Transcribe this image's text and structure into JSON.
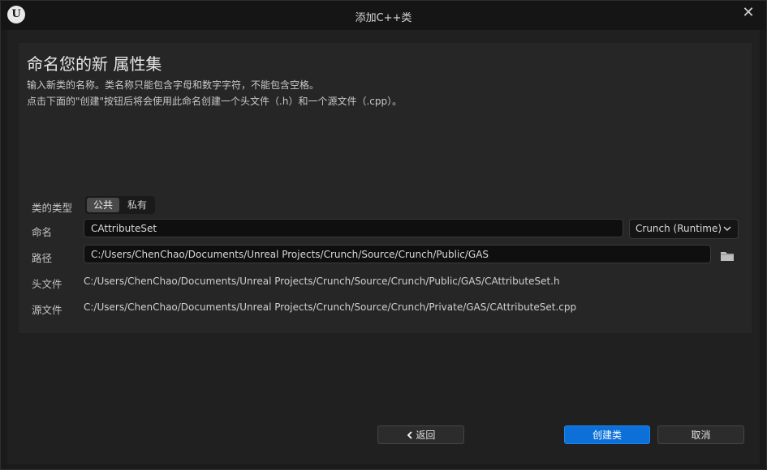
{
  "window": {
    "title": "添加C++类",
    "logo_letter": "U",
    "close_glyph": "✕"
  },
  "header": {
    "heading": "命名您的新 属性集",
    "description_line1": "输入新类的名称。类名称只能包含字母和数字字符，不能包含空格。",
    "description_line2": "点击下面的\"创建\"按钮后将会使用此命名创建一个头文件（.h）和一个源文件（.cpp）。"
  },
  "form": {
    "class_type_label": "类的类型",
    "class_type_options": [
      "公共",
      "私有"
    ],
    "class_type_selected": "公共",
    "name_label": "命名",
    "name_value": "CAttributeSet",
    "module_value": "Crunch (Runtime)",
    "path_label": "路径",
    "path_value": "C:/Users/ChenChao/Documents/Unreal Projects/Crunch/Source/Crunch/Public/GAS",
    "header_file_label": "头文件",
    "header_file_value": "C:/Users/ChenChao/Documents/Unreal Projects/Crunch/Source/Crunch/Public/GAS/CAttributeSet.h",
    "source_file_label": "源文件",
    "source_file_value": "C:/Users/ChenChao/Documents/Unreal Projects/Crunch/Source/Crunch/Private/GAS/CAttributeSet.cpp"
  },
  "footer": {
    "back_label": "返回",
    "back_icon": "chevron-left-icon",
    "create_label": "创建类",
    "cancel_label": "取消"
  },
  "colors": {
    "accent": "#0d6fd8",
    "background": "#1a1a1a",
    "panel": "#262626"
  }
}
